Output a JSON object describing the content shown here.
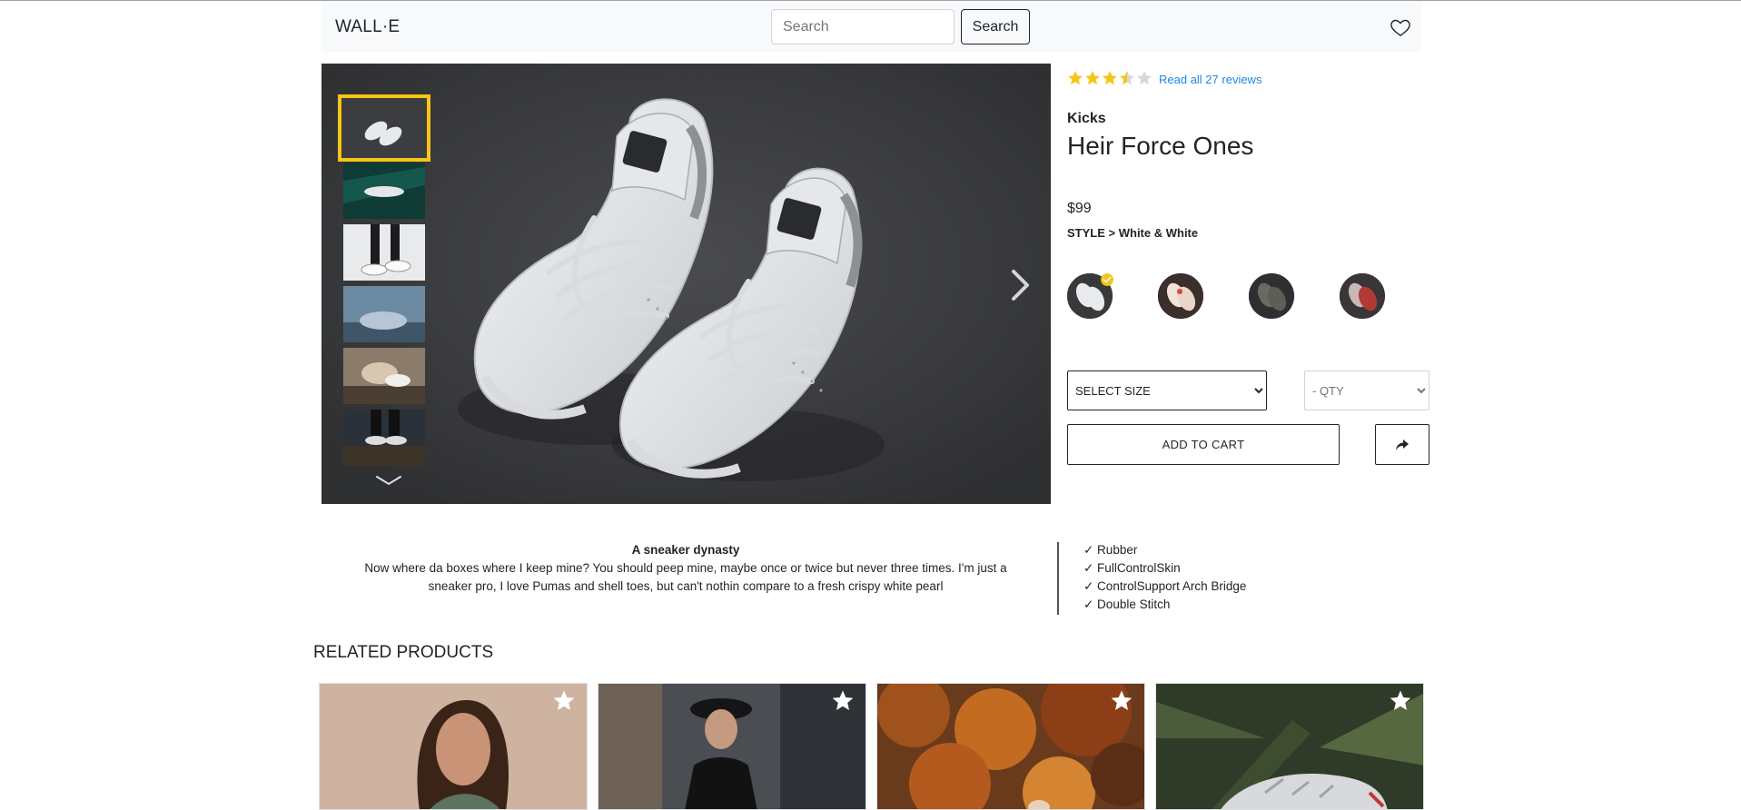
{
  "header": {
    "brand": "WALL·E",
    "search_placeholder": "Search",
    "search_button": "Search"
  },
  "gallery": {
    "thumbnail_count": 6,
    "active_thumbnail": 1
  },
  "product": {
    "rating": 3.5,
    "rating_max": 5,
    "reviews_link": "Read all 27 reviews",
    "category": "Kicks",
    "name": "Heir Force Ones",
    "price": "$99",
    "style_label": "STYLE >",
    "style_value": "White & White",
    "style_count": 4,
    "selected_style": 1
  },
  "cart": {
    "size_default": "SELECT SIZE",
    "qty_default": "- QTY",
    "add_to_cart": "ADD TO CART"
  },
  "description": {
    "title": "A sneaker dynasty",
    "text": "Now where da boxes where I keep mine? You should peep mine, maybe once or twice but never three times. I'm just a sneaker pro, I love Pumas and shell toes, but can't nothin compare to a fresh crispy white pearl",
    "features": [
      "✓ Rubber",
      "✓ FullControlSkin",
      "✓ ControlSupport Arch Bridge",
      "✓ Double Stitch"
    ]
  },
  "related": {
    "title": "RELATED PRODUCTS",
    "card_count": 4
  },
  "colors": {
    "accent_yellow": "#f5c518",
    "link_blue": "#1e88e5",
    "navbar_bg": "#f8f9fa",
    "gallery_bg": "#3a3b3d"
  },
  "icons": {
    "favorite": "heart-icon",
    "next": "chevron-right-icon",
    "thumbs_down": "chevron-down-icon",
    "share": "share-arrow-icon",
    "card_favorite": "star-icon"
  }
}
